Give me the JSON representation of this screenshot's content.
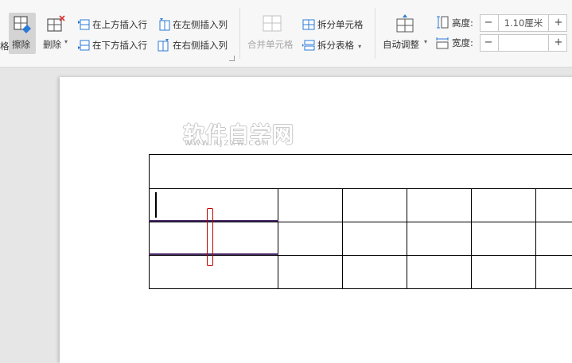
{
  "ribbon": {
    "cut_label": "格",
    "eraser_label": "擦除",
    "delete_label": "删除",
    "insert_above": "在上方插入行",
    "insert_below": "在下方插入行",
    "insert_left": "在左侧插入列",
    "insert_right": "在右侧插入列",
    "merge_cells": "合并单元格",
    "split_cells": "拆分单元格",
    "split_table": "拆分表格",
    "autofit": "自动调整",
    "height_label": "高度:",
    "height_value": "1.10厘米",
    "width_label": "宽度:",
    "width_value": "",
    "minus": "−",
    "plus": "+"
  },
  "document": {
    "watermark": "软件自学网",
    "watermark_url": "WWW.RJZXW.COM"
  },
  "colors": {
    "active_button_bg": "#d4d4d4",
    "table_border": "#000000",
    "erase_highlight": "#c00000"
  }
}
